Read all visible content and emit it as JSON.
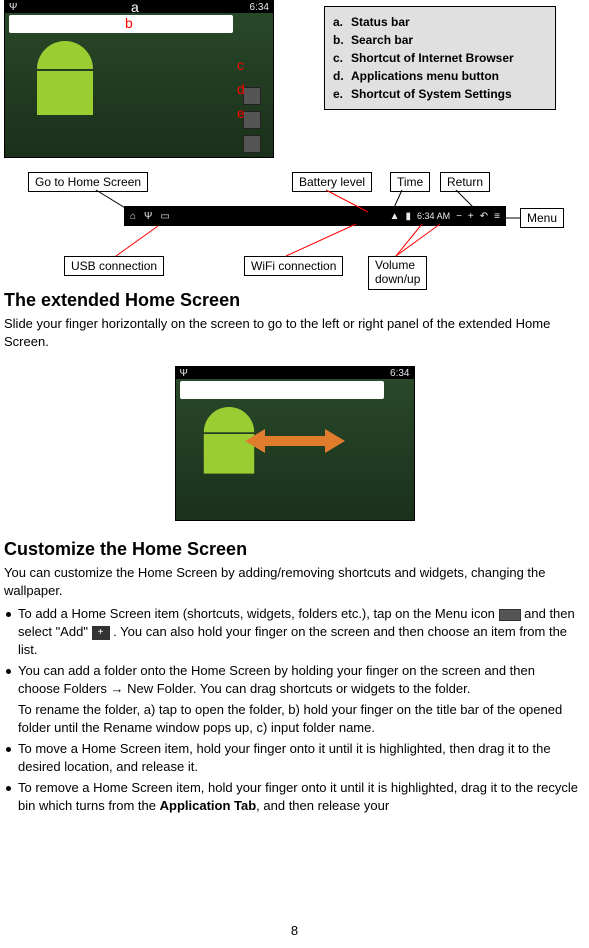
{
  "labels": {
    "a": "a",
    "b": "b",
    "c": "c",
    "d": "d",
    "e": "e"
  },
  "legend": {
    "a": {
      "key": "a.",
      "text": "Status bar"
    },
    "b": {
      "key": "b.",
      "text": "Search bar"
    },
    "c": {
      "key": "c.",
      "text": "Shortcut of Internet Browser"
    },
    "d": {
      "key": "d.",
      "text": "Applications menu button"
    },
    "e": {
      "key": "e.",
      "text": "Shortcut of System Settings"
    }
  },
  "diagram": {
    "gohome": "Go to Home Screen",
    "battery": "Battery level",
    "time": "Time",
    "return": "Return",
    "menu": "Menu",
    "usb": "USB connection",
    "wifi": "WiFi connection",
    "volume": "Volume\ndown/up",
    "statusbar_time": "6:34 AM"
  },
  "headings": {
    "extended": "The extended Home Screen",
    "customize": "Customize the Home Screen"
  },
  "body": {
    "extended_p": "Slide your finger horizontally on the screen to go to the left or right panel of the extended Home Screen.",
    "customize_p": "You can customize the Home Screen by adding/removing shortcuts and widgets, changing the wallpaper.",
    "bullet1a": "To add a Home Screen item (shortcuts, widgets, folders etc.), tap on the Menu icon ",
    "bullet1b": " and then select \"Add\" ",
    "bullet1c": ". You can also hold your finger on the screen and then choose an item from the list.",
    "bullet2": "You can add a folder onto the Home Screen by holding your finger on the screen and then choose Folders → New Folder. You can drag shortcuts or widgets to the folder.",
    "bullet2_sub": "To rename the folder, a) tap to open the folder, b) hold your finger on the title bar of the opened folder until the Rename window pops up, c) input folder name.",
    "bullet3": "To move a Home Screen item, hold your finger onto it until it is highlighted, then drag it to the desired location, and release it.",
    "bullet4a": "To remove a Home Screen item, hold your finger onto it until it is highlighted, drag it to the recycle bin which turns from the ",
    "bullet4_bold": "Application Tab",
    "bullet4b": ", and then release your"
  },
  "page": "8"
}
